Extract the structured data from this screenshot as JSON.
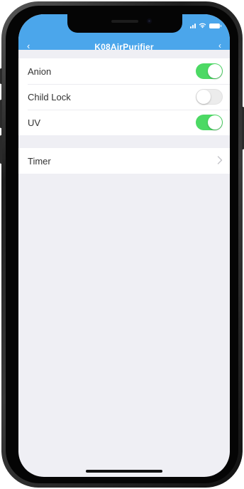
{
  "header": {
    "title": "K08AirPurifier",
    "back_icon": "chevron-left-icon",
    "action_icon": "more-icon",
    "background_color": "#4ba6eb"
  },
  "status_bar": {
    "icons": [
      "signal-icon",
      "wifi-icon",
      "battery-icon"
    ]
  },
  "settings": [
    {
      "label": "Anion",
      "state": "on"
    },
    {
      "label": "Child Lock",
      "state": "off"
    },
    {
      "label": "UV",
      "state": "on"
    }
  ],
  "timer": {
    "label": "Timer",
    "icon": "chevron-right-icon"
  },
  "colors": {
    "toggle_on": "#4cd964",
    "toggle_off": "#ececec",
    "background": "#efeff4"
  }
}
